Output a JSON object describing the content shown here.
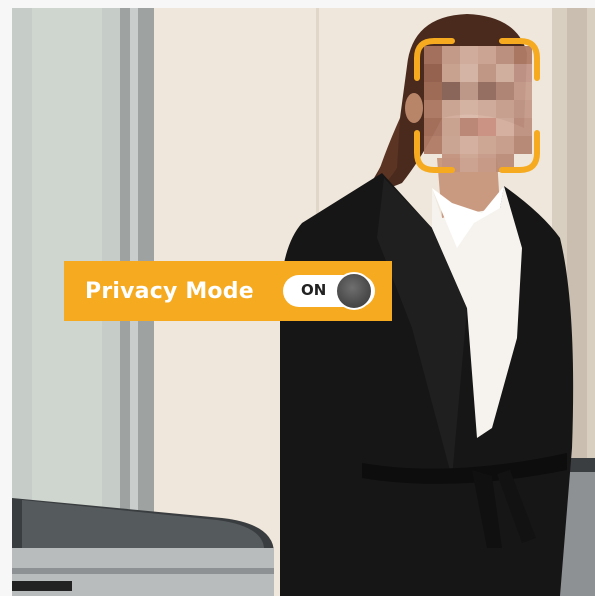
{
  "privacy_mode": {
    "label": "Privacy Mode",
    "toggle_state": "ON",
    "enabled": true
  },
  "colors": {
    "accent": "#f5aa1f",
    "toggle_track": "#ffffff",
    "toggle_knob": "#4b4b4b",
    "face_frame": "#f5aa1f"
  },
  "icons": {
    "face_frame": "face-detection-frame-icon"
  }
}
